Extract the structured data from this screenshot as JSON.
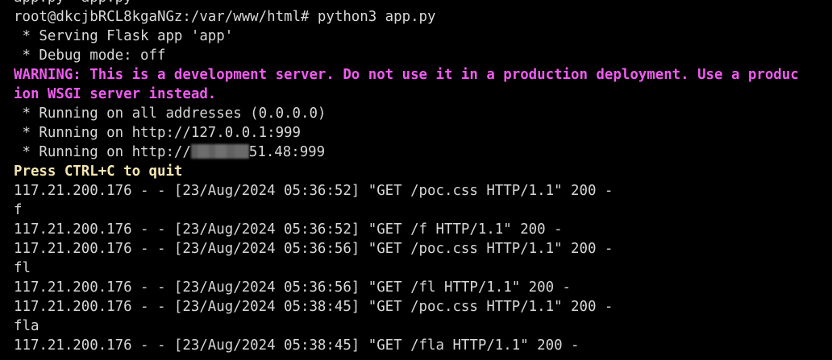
{
  "terminal": {
    "colors": {
      "background": "#000000",
      "foreground": "#d8d8d8",
      "warning": "#f15bf0",
      "hint": "#f5e6b0"
    },
    "lines": [
      "app.py  app.py",
      "root@dkcjbRCL8kgaNGz:/var/www/html# python3 app.py",
      " * Serving Flask app 'app'",
      " * Debug mode: off",
      "WARNING: This is a development server. Do not use it in a production deployment. Use a production WSGI server instead.",
      " * Running on all addresses (0.0.0.0)",
      " * Running on http://127.0.0.1:999",
      " * Running on http://",
      "Press CTRL+C to quit",
      "117.21.200.176 - - [23/Aug/2024 05:36:52] \"GET /poc.css HTTP/1.1\" 200 -",
      "f",
      "117.21.200.176 - - [23/Aug/2024 05:36:52] \"GET /f HTTP/1.1\" 200 -",
      "117.21.200.176 - - [23/Aug/2024 05:36:56] \"GET /poc.css HTTP/1.1\" 200 -",
      "fl",
      "117.21.200.176 - - [23/Aug/2024 05:36:56] \"GET /fl HTTP/1.1\" 200 -",
      "117.21.200.176 - - [23/Aug/2024 05:38:45] \"GET /poc.css HTTP/1.1\" 200 -",
      "fla",
      "117.21.200.176 - - [23/Aug/2024 05:38:45] \"GET /fla HTTP/1.1\" 200 -"
    ],
    "warning_line_1": "WARNING: This is a development server. Do not use it in a production deployment. Use a produc",
    "warning_line_2": "ion WSGI server instead.",
    "running_public_suffix": "51.48:999"
  }
}
